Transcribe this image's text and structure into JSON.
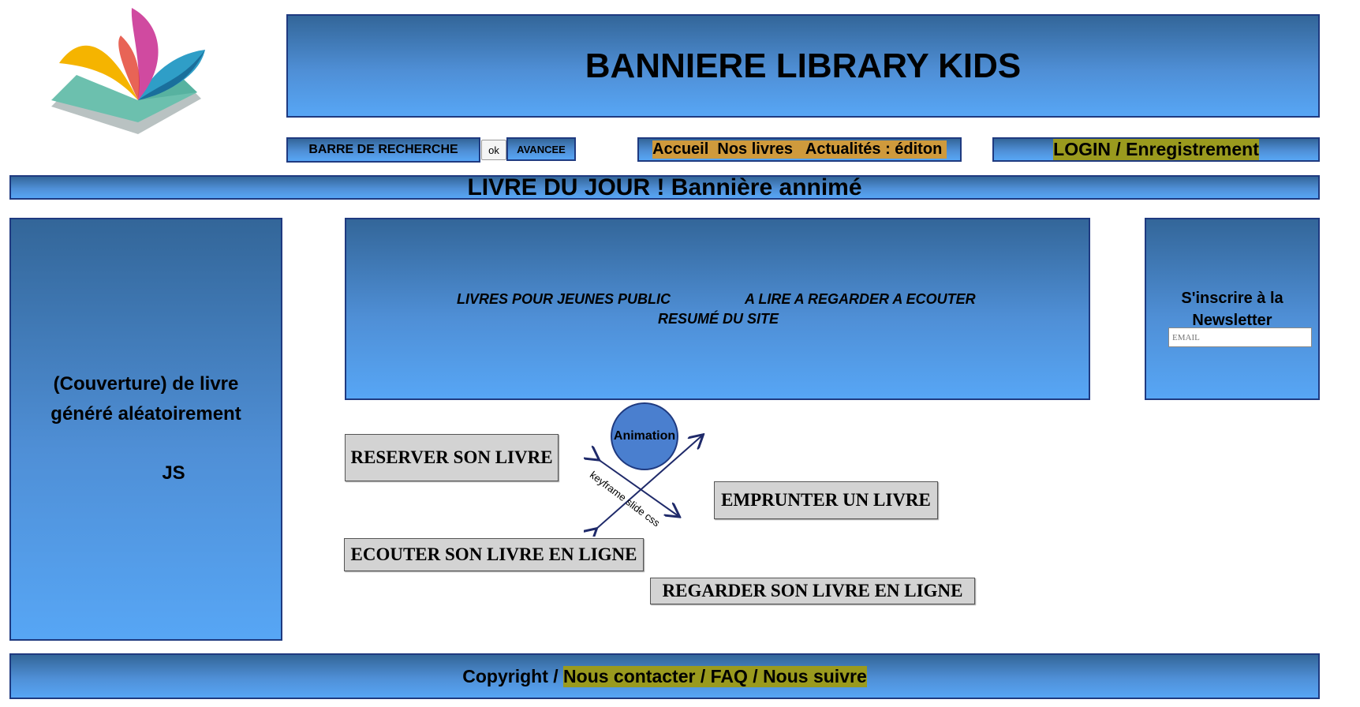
{
  "header": {
    "banner_title": "BANNIERE LIBRARY KIDS",
    "search_label": "BARRE DE RECHERCHE",
    "ok_label": "ok",
    "advanced_label": "AVANCEE",
    "nav_label": "Accueil  Nos livres   Actualités : éditon ",
    "login_label": "LOGIN / Enregistrement"
  },
  "daily_banner": {
    "title": "LIVRE DU JOUR ! Bannière annimé"
  },
  "left_panel": {
    "line1": "(Couverture) de livre",
    "line2": "généré aléatoirement",
    "line3": "JS"
  },
  "center_panel": {
    "text_a": "LIVRES POUR JEUNES PUBLIC",
    "text_b": "A LIRE A REGARDER A ECOUTER",
    "text_c": "RESUMÉ DU SITE"
  },
  "newsletter": {
    "title": "S'inscrire à la Newsletter",
    "email_placeholder": "EMAIL"
  },
  "actions": {
    "reserve": "RESERVER SON LIVRE",
    "borrow": "EMPRUNTER UN LIVRE",
    "listen": "ECOUTER SON LIVRE EN LIGNE",
    "watch": "REGARDER SON LIVRE EN LIGNE"
  },
  "animation": {
    "label": "Animation",
    "arrow_caption": "keyframe slide css"
  },
  "footer": {
    "copyright": "Copyright / ",
    "links": "Nous contacter / FAQ / Nous suivre"
  },
  "colors": {
    "blue_top": "#336699",
    "blue_bottom": "#57a6f5",
    "border": "#1f3a80",
    "highlight_olive": "#9a9a1e",
    "highlight_orange": "#cf9a3c",
    "button_grey": "#d3d3d3"
  }
}
